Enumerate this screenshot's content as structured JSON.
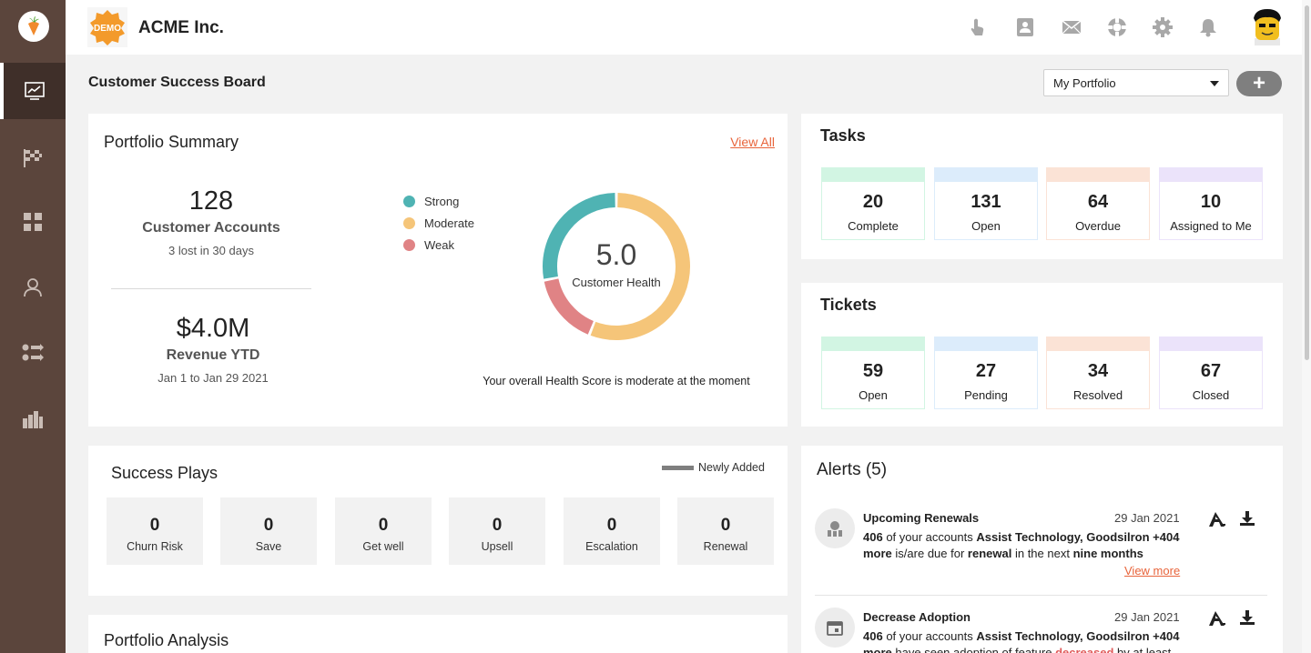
{
  "app": {
    "company": "ACME Inc.",
    "logo_text": "DEMO"
  },
  "sidebar": {
    "items": [
      {
        "name": "dashboard",
        "icon": "line-chart-icon",
        "active": true
      },
      {
        "name": "plays",
        "icon": "checkered-flag-icon",
        "active": false
      },
      {
        "name": "apps",
        "icon": "grid-icon",
        "active": false
      },
      {
        "name": "customers",
        "icon": "person-icon",
        "active": false
      },
      {
        "name": "workflows",
        "icon": "flow-icon",
        "active": false
      },
      {
        "name": "reports",
        "icon": "bar-chart-icon",
        "active": false
      }
    ]
  },
  "header_icons": [
    "touch-icon",
    "contacts-icon",
    "mail-icon",
    "support-icon",
    "gear-icon",
    "bell-icon"
  ],
  "page": {
    "title": "Customer Success Board",
    "portfolio_select": "My Portfolio",
    "add_label": "+"
  },
  "portfolio_summary": {
    "title": "Portfolio Summary",
    "view_all": "View All",
    "accounts": {
      "value": "128",
      "label": "Customer Accounts",
      "sub": "3 lost in 30 days"
    },
    "revenue": {
      "value": "$4.0M",
      "label": "Revenue YTD",
      "sub": "Jan 1 to Jan 29 2021"
    },
    "legend": [
      {
        "label": "Strong",
        "color": "#4fb3b3"
      },
      {
        "label": "Moderate",
        "color": "#f5c579"
      },
      {
        "label": "Weak",
        "color": "#e08385"
      }
    ],
    "health": {
      "value": "5.0",
      "label": "Customer Health"
    },
    "health_note": "Your overall Health Score is moderate at the moment"
  },
  "chart_data": {
    "type": "pie",
    "categories": [
      "Strong",
      "Moderate",
      "Weak"
    ],
    "values": [
      28,
      56,
      16
    ],
    "title": "",
    "center_value": "5.0",
    "center_label": "Customer Health"
  },
  "tasks": {
    "title": "Tasks",
    "stats": [
      {
        "value": "20",
        "label": "Complete",
        "color": "#d2f5e3"
      },
      {
        "value": "131",
        "label": "Open",
        "color": "#dcecfb"
      },
      {
        "value": "64",
        "label": "Overdue",
        "color": "#fbe3d6"
      },
      {
        "value": "10",
        "label": "Assigned to Me",
        "color": "#ebe3fa"
      }
    ]
  },
  "tickets": {
    "title": "Tickets",
    "stats": [
      {
        "value": "59",
        "label": "Open",
        "color": "#d2f5e3"
      },
      {
        "value": "27",
        "label": "Pending",
        "color": "#dcecfb"
      },
      {
        "value": "34",
        "label": "Resolved",
        "color": "#fbe3d6"
      },
      {
        "value": "67",
        "label": "Closed",
        "color": "#ebe3fa"
      }
    ]
  },
  "success_plays": {
    "title": "Success Plays",
    "legend": "Newly Added",
    "plays": [
      {
        "value": "0",
        "label": "Churn Risk"
      },
      {
        "value": "0",
        "label": "Save"
      },
      {
        "value": "0",
        "label": "Get well"
      },
      {
        "value": "0",
        "label": "Upsell"
      },
      {
        "value": "0",
        "label": "Escalation"
      },
      {
        "value": "0",
        "label": "Renewal"
      }
    ]
  },
  "portfolio_analysis": {
    "title": "Portfolio Analysis"
  },
  "alerts": {
    "title": "Alerts (5)",
    "items": [
      {
        "title": "Upcoming Renewals",
        "date": "29 Jan 2021",
        "count": "406",
        "t1": "of your accounts",
        "accounts": "Assist Technology, Goodsilron +404",
        "more_word": "more",
        "t2": "is/are due for",
        "kw1": "renewal",
        "t3": "in the next",
        "kw2": "nine months",
        "view_more": "View more"
      },
      {
        "title": "Decrease Adoption",
        "date": "29 Jan 2021",
        "count": "406",
        "t1": "of your accounts",
        "accounts": "Assist Technology, Goodsilron +404",
        "more_word": "more",
        "t2": "have seen adoption of feature",
        "kw1": "decreased",
        "t3": "by at least"
      }
    ]
  }
}
